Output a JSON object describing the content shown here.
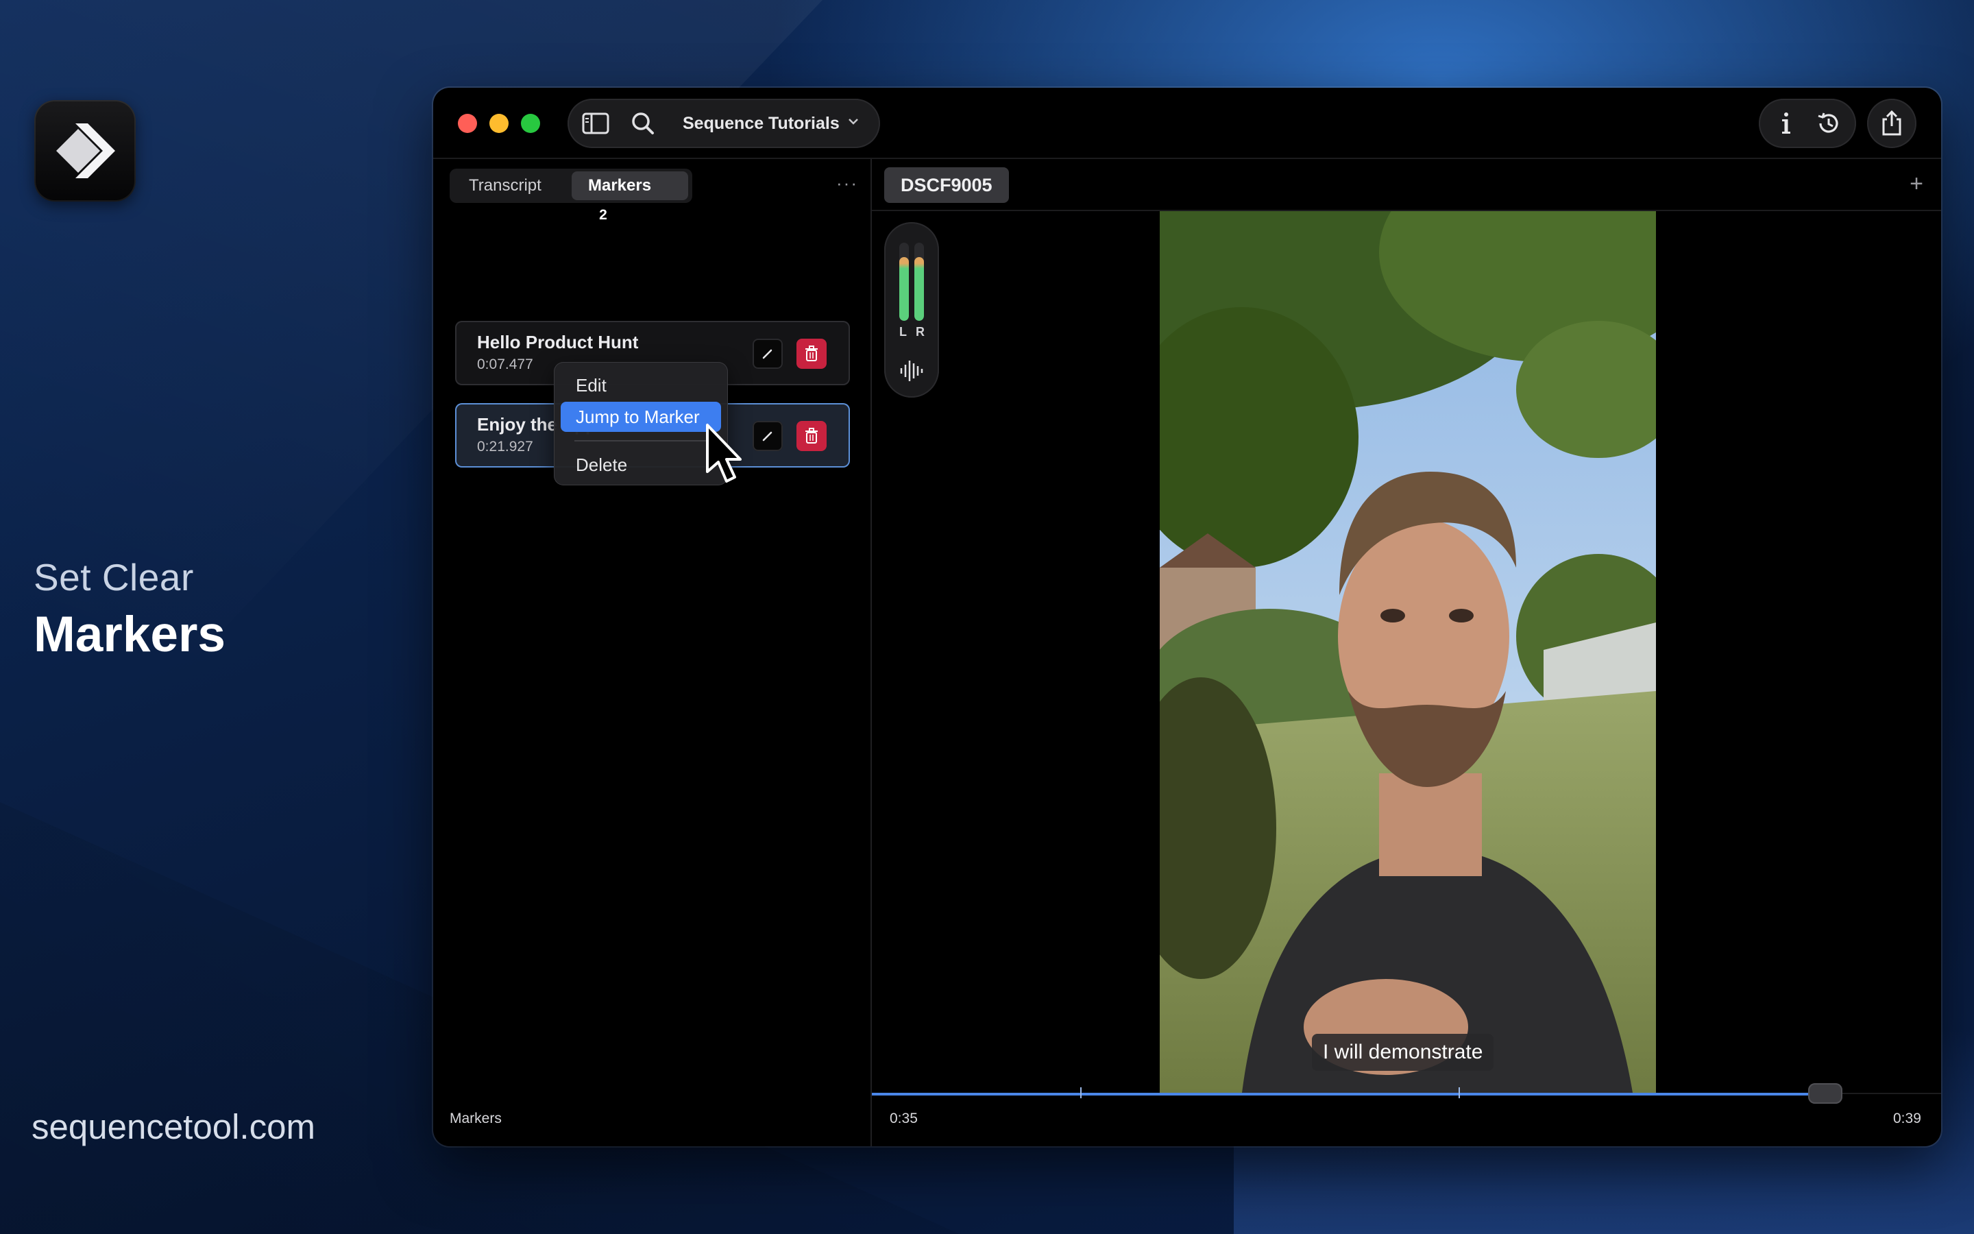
{
  "promo": {
    "subtitle": "Set Clear",
    "title": "Markers",
    "url": "sequencetool.com"
  },
  "window": {
    "project_name": "Sequence Tutorials",
    "icons": {
      "sidebar": "sidebar-icon",
      "search": "search-icon",
      "info": "info-icon",
      "history": "history-icon",
      "share": "share-icon"
    }
  },
  "left_panel": {
    "tabs": [
      {
        "label": "Transcript",
        "active": false
      },
      {
        "label": "Markers",
        "active": true,
        "count": "2"
      }
    ],
    "markers": [
      {
        "title": "Hello Product Hunt",
        "time": "0:07.477",
        "selected": false
      },
      {
        "title": "Enjoy the App!",
        "time": "0:21.927",
        "selected": true
      }
    ],
    "context_menu": {
      "items": [
        "Edit",
        "Jump to Marker",
        "Delete"
      ],
      "highlighted": "Jump to Marker"
    },
    "footer_label": "Markers"
  },
  "viewer": {
    "clip_name": "DSCF9005",
    "meter": {
      "left_label": "L",
      "right_label": "R",
      "left_level": 0.82,
      "right_level": 0.82
    },
    "subtitle": "I will demonstrate",
    "timeline": {
      "start": "0:35",
      "end": "0:39"
    }
  },
  "colors": {
    "accent": "#3d7ef0",
    "delete": "#c8223f",
    "meter_green": "#5bcf7c",
    "meter_orange": "#e0a860"
  }
}
